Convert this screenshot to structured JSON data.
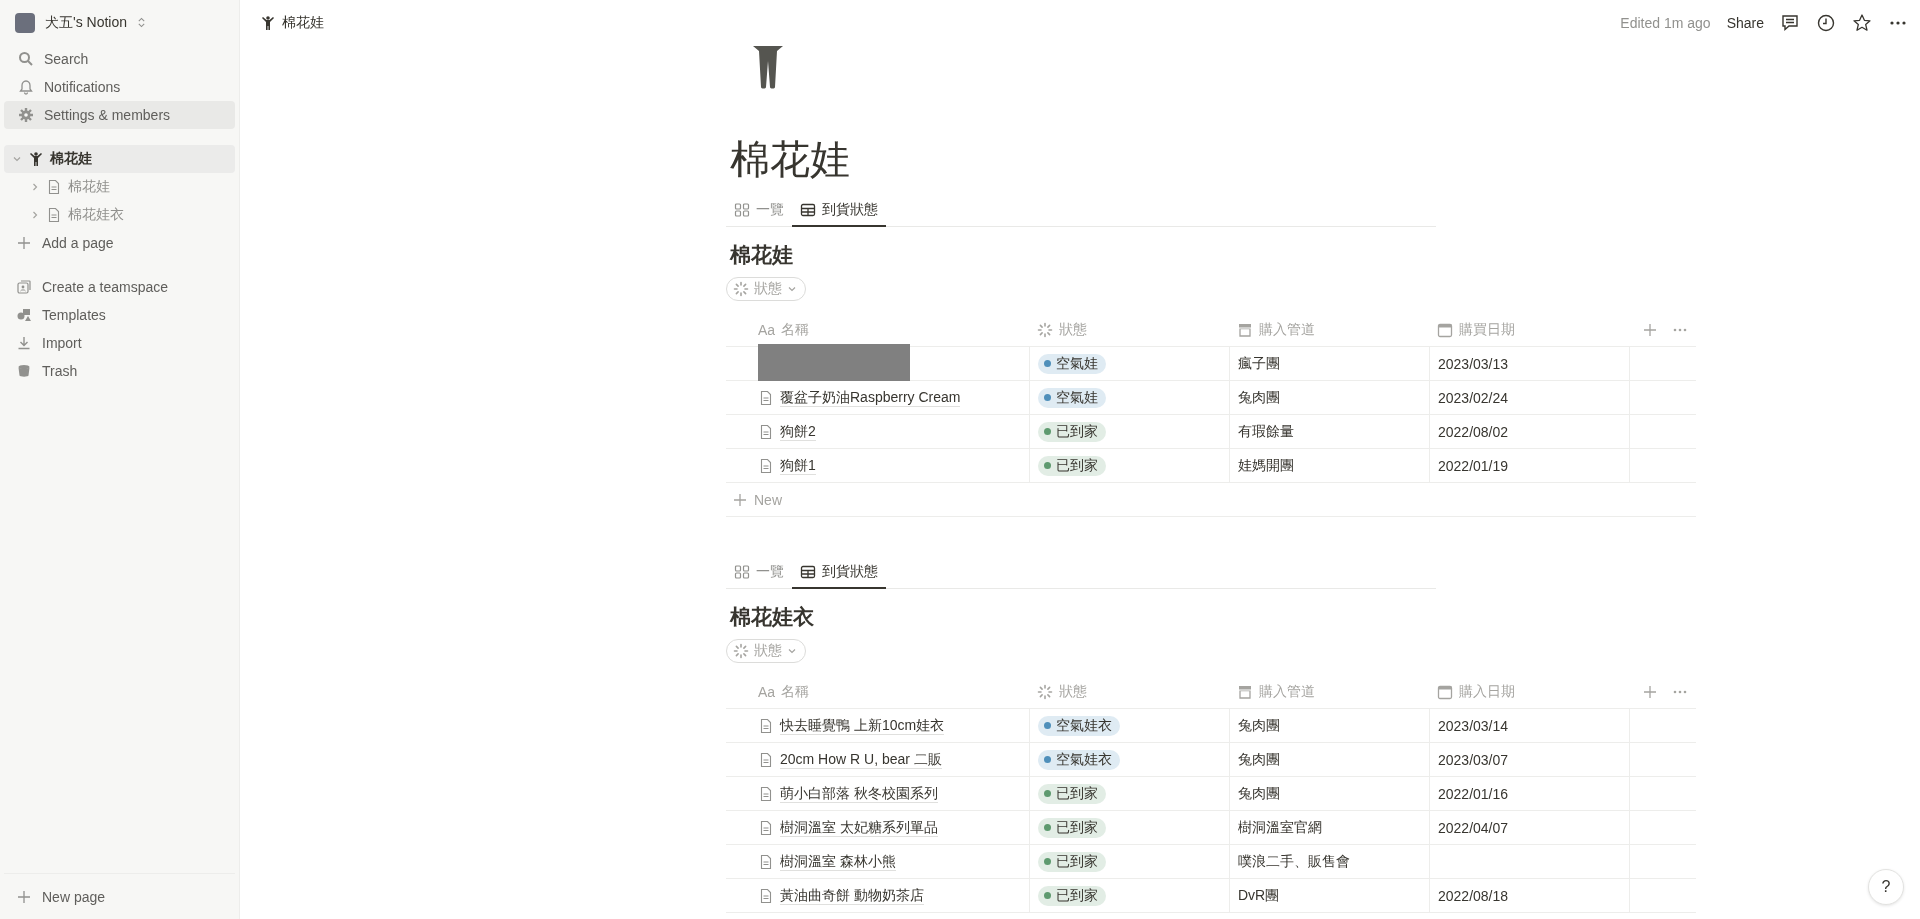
{
  "sidebar": {
    "workspace": "犬五's Notion",
    "items": [
      {
        "kind": "search",
        "label": "Search",
        "selected": false
      },
      {
        "kind": "notifications",
        "label": "Notifications",
        "selected": false
      },
      {
        "kind": "settings",
        "label": "Settings & members",
        "selected": true
      }
    ],
    "tree": [
      {
        "kind": "figure",
        "label": "棉花娃",
        "expanded": true,
        "selected": true,
        "children": [
          {
            "kind": "page",
            "label": "棉花娃",
            "expanded": false,
            "selected": false
          },
          {
            "kind": "page",
            "label": "棉花娃衣",
            "expanded": false,
            "selected": false
          }
        ]
      }
    ],
    "add_page": "Add a page",
    "tools": [
      {
        "kind": "teamspace",
        "label": "Create a teamspace"
      },
      {
        "kind": "templates",
        "label": "Templates"
      },
      {
        "kind": "import",
        "label": "Import"
      },
      {
        "kind": "trash",
        "label": "Trash"
      }
    ],
    "new_page": "New page"
  },
  "topbar": {
    "breadcrumb": "棉花娃",
    "edited": "Edited 1m ago",
    "share": "Share"
  },
  "page": {
    "title": "棉花娃",
    "databases": [
      {
        "tabs": [
          {
            "kind": "gallery",
            "label": "一覽",
            "selected": false
          },
          {
            "kind": "table",
            "label": "到貨狀態",
            "selected": true
          }
        ],
        "title": "棉花娃",
        "filter": "狀態",
        "columns": [
          {
            "kind": "title",
            "prefix": "Aa",
            "label": "名稱"
          },
          {
            "kind": "status",
            "label": "狀態"
          },
          {
            "kind": "select",
            "label": "購入管道"
          },
          {
            "kind": "date",
            "label": "購買日期"
          }
        ],
        "rows": [
          {
            "redacted": true,
            "status": {
              "label": "空氣娃",
              "color": "#4f8fba"
            },
            "channel": "瘋子團",
            "date": "2023/03/13"
          },
          {
            "redacted": false,
            "name": "覆盆子奶油Raspberry Cream",
            "status": {
              "label": "空氣娃",
              "color": "#4f8fba"
            },
            "channel": "兔肉團",
            "date": "2023/02/24"
          },
          {
            "redacted": false,
            "name": "狗餅2",
            "status": {
              "label": "已到家",
              "color": "#5e9a6f"
            },
            "channel": "有瑕餘量",
            "date": "2022/08/02"
          },
          {
            "redacted": false,
            "name": "狗餅1",
            "status": {
              "label": "已到家",
              "color": "#5e9a6f"
            },
            "channel": "娃媽開團",
            "date": "2022/01/19"
          }
        ],
        "new_label": "New"
      },
      {
        "tabs": [
          {
            "kind": "gallery",
            "label": "一覽",
            "selected": false
          },
          {
            "kind": "table",
            "label": "到貨狀態",
            "selected": true
          }
        ],
        "title": "棉花娃衣",
        "filter": "狀態",
        "columns": [
          {
            "kind": "title",
            "prefix": "Aa",
            "label": "名稱"
          },
          {
            "kind": "status",
            "label": "狀態"
          },
          {
            "kind": "select",
            "label": "購入管道"
          },
          {
            "kind": "date",
            "label": "購入日期"
          }
        ],
        "rows": [
          {
            "redacted": false,
            "name": "快去睡覺鴨 上新10cm娃衣",
            "status": {
              "label": "空氣娃衣",
              "color": "#4f8fba"
            },
            "channel": "兔肉團",
            "date": "2023/03/14"
          },
          {
            "redacted": false,
            "name": "20cm How R U, bear 二販",
            "status": {
              "label": "空氣娃衣",
              "color": "#4f8fba"
            },
            "channel": "兔肉團",
            "date": "2023/03/07"
          },
          {
            "redacted": false,
            "name": "萌小白部落 秋冬校園系列",
            "status": {
              "label": "已到家",
              "color": "#5e9a6f"
            },
            "channel": "兔肉團",
            "date": "2022/01/16"
          },
          {
            "redacted": false,
            "name": "樹洞溫室 太妃糖系列單品",
            "status": {
              "label": "已到家",
              "color": "#5e9a6f"
            },
            "channel": "樹洞溫室官網",
            "date": "2022/04/07"
          },
          {
            "redacted": false,
            "name": "樹洞溫室 森林小熊",
            "status": {
              "label": "已到家",
              "color": "#5e9a6f"
            },
            "channel": "噗浪二手、販售會"
          },
          {
            "redacted": false,
            "name": "黃油曲奇餅 動物奶茶店",
            "status": {
              "label": "已到家",
              "color": "#5e9a6f"
            },
            "channel": "DvR團",
            "date": "2022/08/18"
          }
        ]
      }
    ]
  },
  "help_button": "?"
}
